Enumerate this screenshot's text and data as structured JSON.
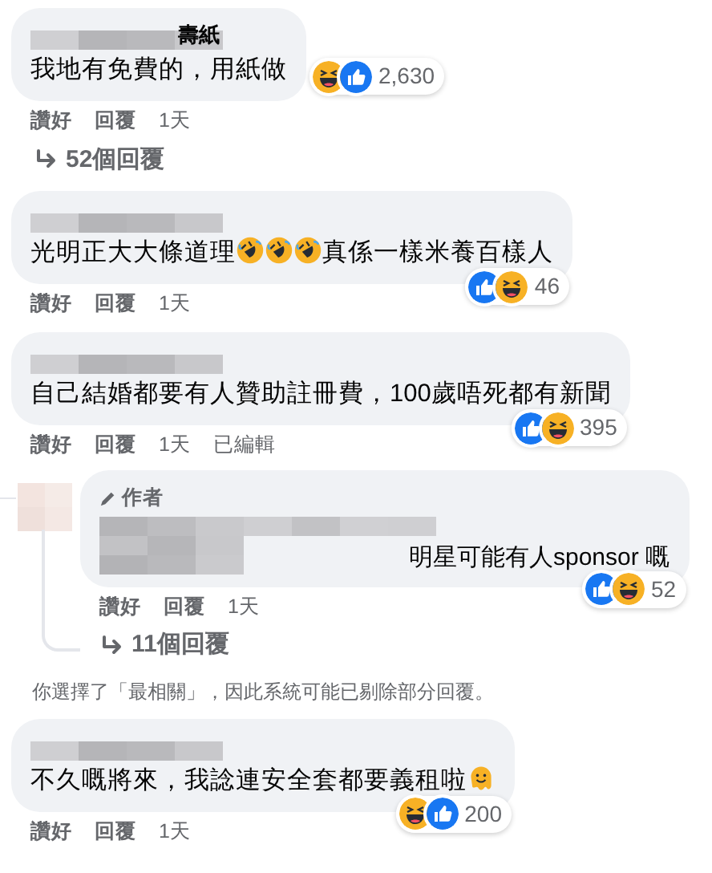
{
  "comments": [
    {
      "name": "壽紙",
      "segments": [
        {
          "kind": "text",
          "text": "我地有免費的，用紙做"
        }
      ],
      "reaction_badge": {
        "kind": "beside",
        "icons": [
          {
            "kind": "haha"
          },
          {
            "kind": "like"
          }
        ],
        "count": "2,630"
      },
      "actions": [
        "讚好",
        "回覆",
        "1天"
      ],
      "more_replies": "52個回覆"
    },
    {
      "segments": [
        {
          "kind": "text",
          "text": "光明正大大條道理"
        },
        {
          "kind": "rofl"
        },
        {
          "kind": "rofl"
        },
        {
          "kind": "rofl"
        },
        {
          "kind": "text",
          "text": "真係一樣米養百樣人"
        }
      ],
      "reaction_badge": {
        "kind": "corner",
        "icons": [
          {
            "kind": "like"
          },
          {
            "kind": "haha"
          }
        ],
        "count": "46"
      },
      "actions": [
        "讚好",
        "回覆",
        "1天"
      ]
    },
    {
      "segments": [
        {
          "kind": "text",
          "text": "自己結婚都要有人贊助註冊費，100歲唔死都有新聞"
        }
      ],
      "reaction_badge": {
        "kind": "corner",
        "icons": [
          {
            "kind": "like"
          },
          {
            "kind": "haha"
          }
        ],
        "count": "395"
      },
      "actions": [
        "讚好",
        "回覆",
        "1天",
        "已編輯"
      ],
      "replies": [
        {
          "author_badge": "作者",
          "segments": [
            {
              "kind": "text",
              "text": "明星可能有人sponsor 嘅"
            }
          ],
          "reaction_badge": {
            "kind": "corner",
            "icons": [
              {
                "kind": "like"
              },
              {
                "kind": "haha"
              }
            ],
            "count": "52"
          },
          "actions": [
            "讚好",
            "回覆",
            "1天"
          ]
        }
      ],
      "thread_more_replies": "11個回覆"
    }
  ],
  "notice": "你選擇了「最相關」，因此系統可能已剔除部分回覆。",
  "comments_after": [
    {
      "segments": [
        {
          "kind": "text",
          "text": "不久嘅將來，我諗連安全套都要義租啦"
        },
        {
          "kind": "melting"
        }
      ],
      "reaction_badge": {
        "kind": "corner",
        "icons": [
          {
            "kind": "haha"
          },
          {
            "kind": "like"
          }
        ],
        "count": "200"
      },
      "actions": [
        "讚好",
        "回覆",
        "1天"
      ]
    }
  ]
}
